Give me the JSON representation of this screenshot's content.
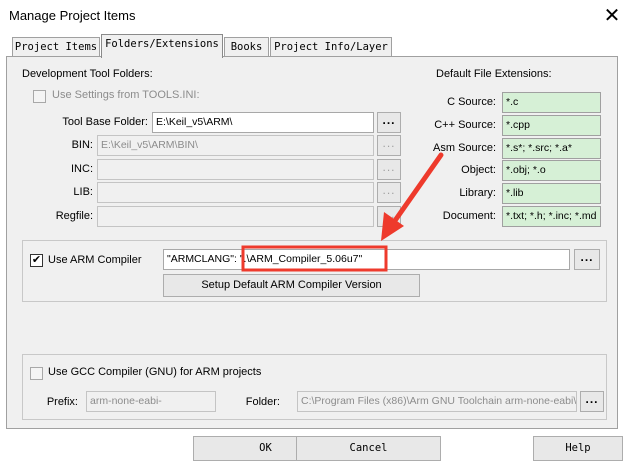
{
  "window": {
    "title": "Manage Project Items",
    "close_glyph": "✕"
  },
  "tabs": [
    {
      "label": "Project Items",
      "active": false
    },
    {
      "label": "Folders/Extensions",
      "active": true
    },
    {
      "label": "Books",
      "active": false
    },
    {
      "label": "Project Info/Layer",
      "active": false
    }
  ],
  "dev_tools": {
    "section_label": "Development Tool Folders:",
    "use_settings_label": "Use Settings from TOOLS.INI:",
    "use_settings_checked": false,
    "tool_base": {
      "label": "Tool Base Folder:",
      "value": "E:\\Keil_v5\\ARM\\"
    },
    "bin": {
      "label": "BIN:",
      "value": "E:\\Keil_v5\\ARM\\BIN\\"
    },
    "inc": {
      "label": "INC:",
      "value": ""
    },
    "lib": {
      "label": "LIB:",
      "value": ""
    },
    "regfile": {
      "label": "Regfile:",
      "value": ""
    },
    "browse_label": "..."
  },
  "extensions": {
    "section_label": "Default File Extensions:",
    "c_source": {
      "label": "C Source:",
      "value": "*.c"
    },
    "cpp_source": {
      "label": "C++ Source:",
      "value": "*.cpp"
    },
    "asm_source": {
      "label": "Asm Source:",
      "value": "*.s*; *.src; *.a*"
    },
    "object": {
      "label": "Object:",
      "value": "*.obj; *.o"
    },
    "library": {
      "label": "Library:",
      "value": "*.lib"
    },
    "document": {
      "label": "Document:",
      "value": "*.txt; *.h; *.inc; *.md"
    }
  },
  "arm_compiler": {
    "use_label": "Use ARM Compiler",
    "checked": true,
    "check_glyph": "✔",
    "value_prefix": "\"ARMCLANG\":",
    "value_highlight": "\".\\ARM_Compiler_5.06u7\"",
    "browse_label": "...",
    "setup_button": "Setup Default ARM Compiler Version"
  },
  "gcc": {
    "use_label": "Use GCC Compiler (GNU) for ARM projects",
    "checked": false,
    "prefix_label": "Prefix:",
    "prefix_value": "arm-none-eabi-",
    "folder_label": "Folder:",
    "folder_value": "C:\\Program Files (x86)\\Arm GNU Toolchain arm-none-eabi\\",
    "browse_label": "..."
  },
  "footer": {
    "ok": "OK",
    "cancel": "Cancel",
    "help": "Help"
  },
  "annotation": {
    "color": "#ee3a2c"
  }
}
